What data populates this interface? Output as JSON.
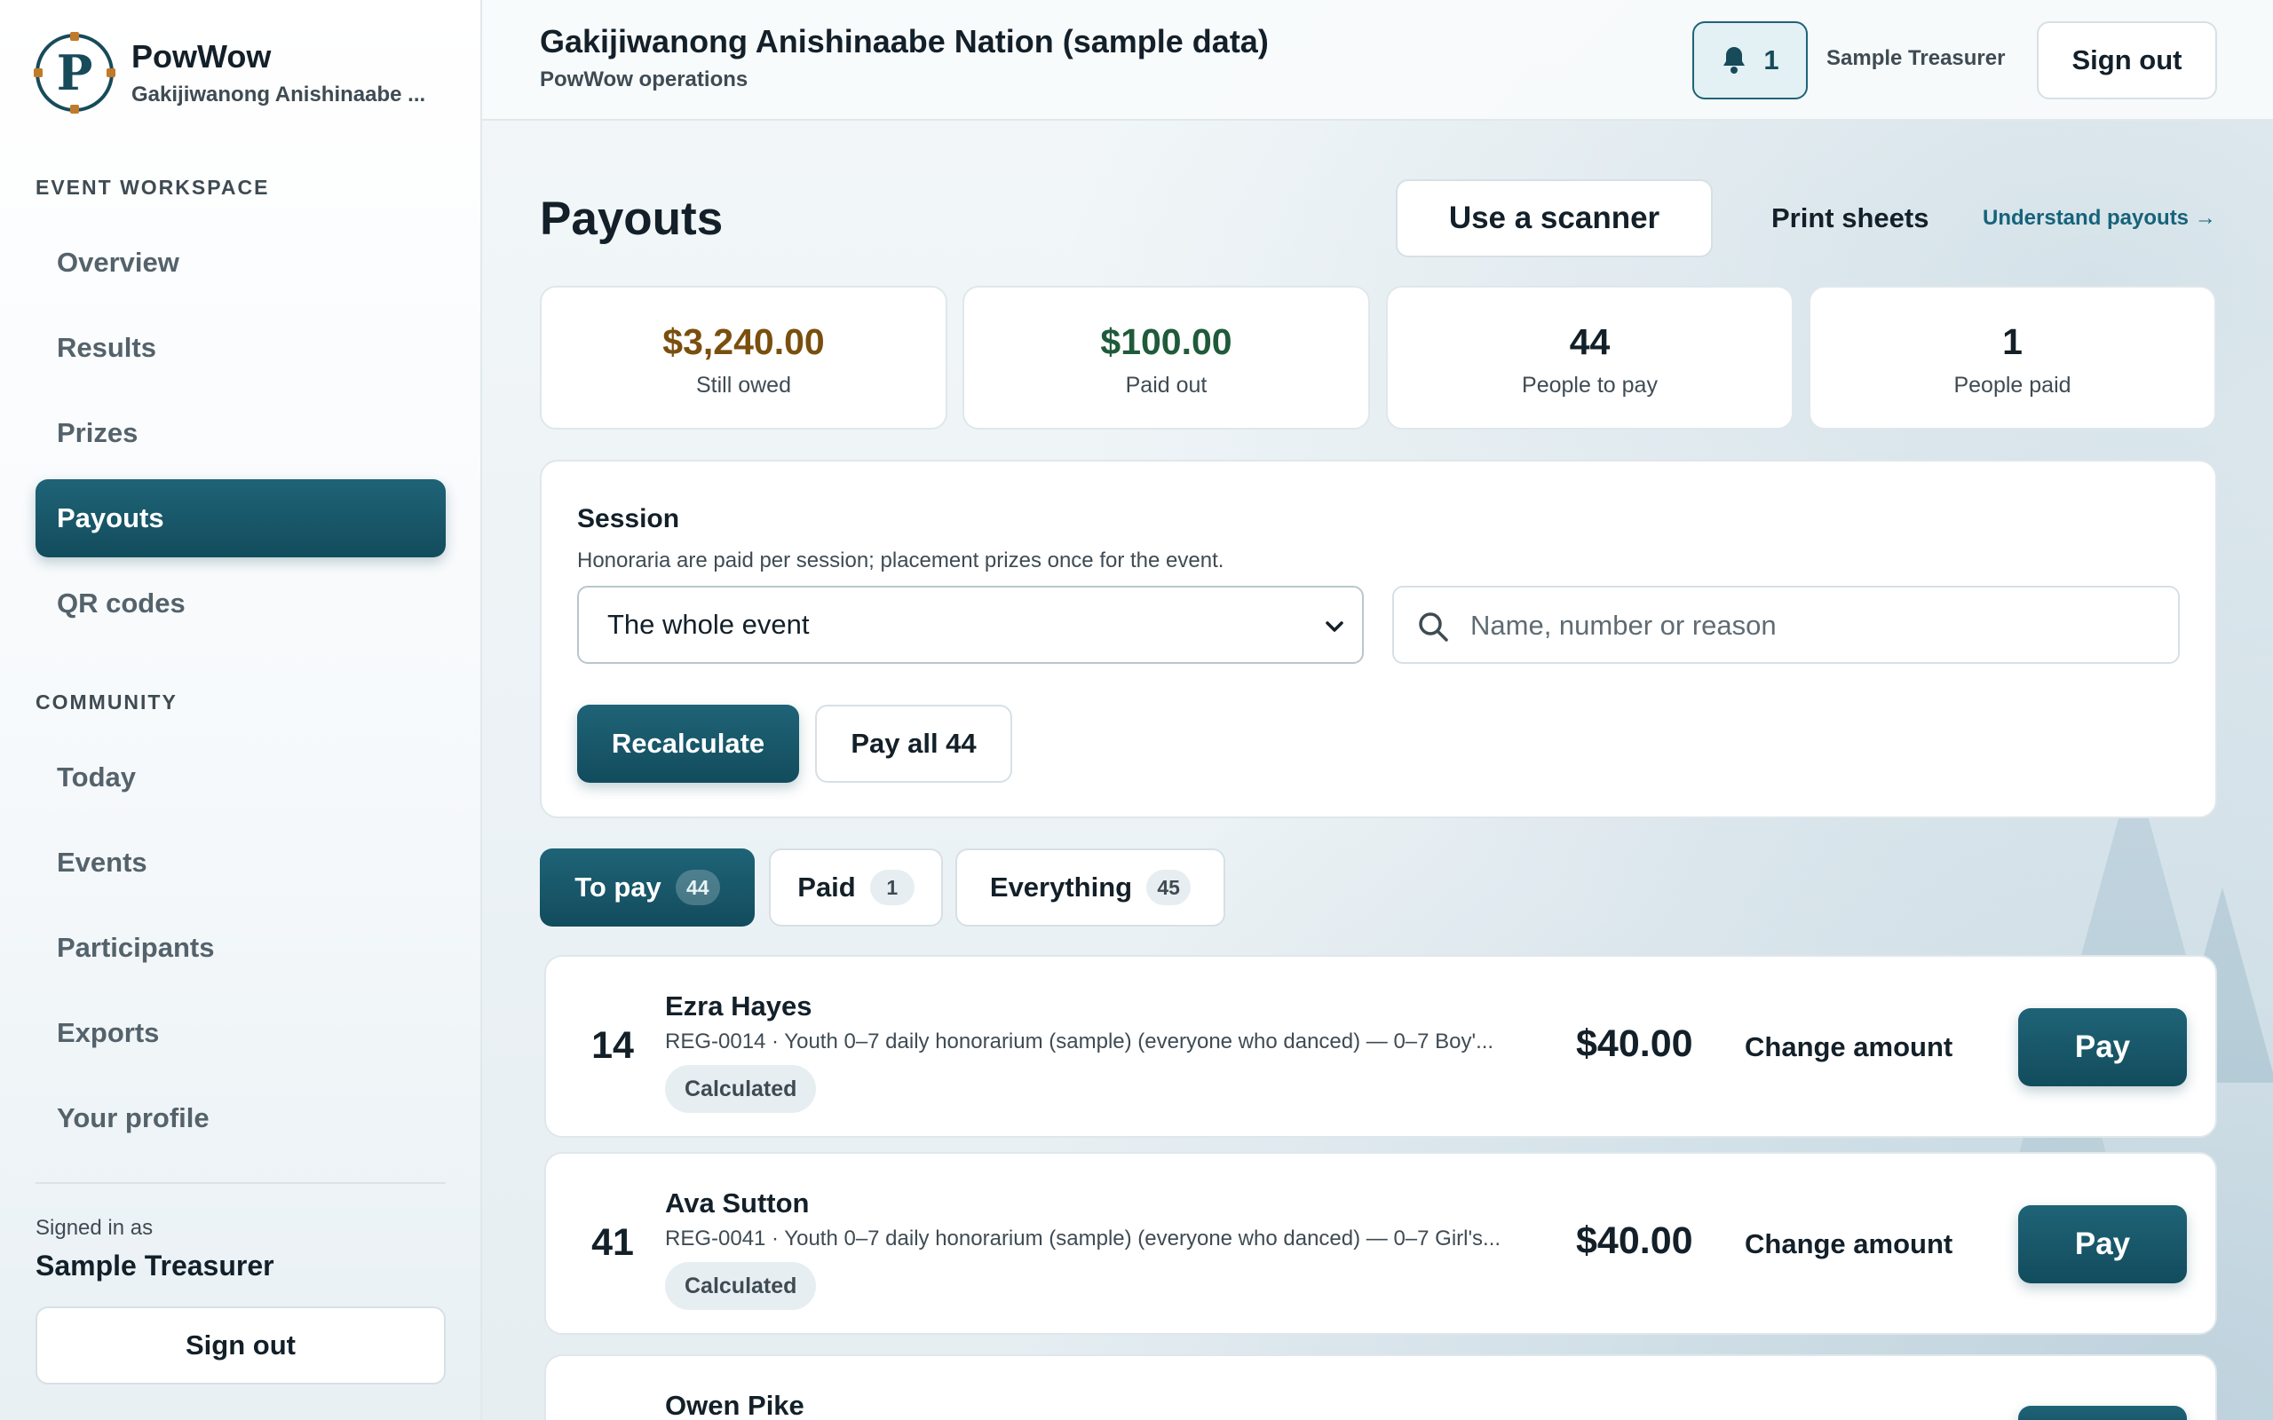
{
  "brand": {
    "name": "PowWow",
    "org_short": "Gakijiwanong Anishinaabe ...",
    "logo_letter": "P"
  },
  "sidebar": {
    "workspace_label": "EVENT WORKSPACE",
    "workspace_items": [
      {
        "label": "Overview",
        "active": false
      },
      {
        "label": "Results",
        "active": false
      },
      {
        "label": "Prizes",
        "active": false
      },
      {
        "label": "Payouts",
        "active": true
      },
      {
        "label": "QR codes",
        "active": false
      }
    ],
    "community_label": "COMMUNITY",
    "community_items": [
      {
        "label": "Today"
      },
      {
        "label": "Events"
      },
      {
        "label": "Participants"
      },
      {
        "label": "Exports"
      },
      {
        "label": "Your profile"
      }
    ],
    "signed_in_label": "Signed in as",
    "signed_in_name": "Sample Treasurer",
    "sign_out_label": "Sign out"
  },
  "header": {
    "org_title": "Gakijiwanong Anishinaabe Nation (sample data)",
    "org_subtitle": "PowWow operations",
    "notification_count": "1",
    "user_name": "Sample Treasurer",
    "sign_out_label": "Sign out"
  },
  "page": {
    "title": "Payouts",
    "scanner_label": "Use a scanner",
    "print_label": "Print sheets",
    "understand_label": "Understand payouts →"
  },
  "stats": [
    {
      "value": "$3,240.00",
      "label": "Still owed",
      "color": "#7a4f0e"
    },
    {
      "value": "$100.00",
      "label": "Paid out",
      "color": "#1f5b3a"
    },
    {
      "value": "44",
      "label": "People to pay",
      "color": "#132029"
    },
    {
      "value": "1",
      "label": "People paid",
      "color": "#132029"
    }
  ],
  "session": {
    "title": "Session",
    "hint": "Honoraria are paid per session; placement prizes once for the event.",
    "selected": "The whole event",
    "search_placeholder": "Name, number or reason",
    "recalculate_label": "Recalculate",
    "pay_all_label": "Pay all 44"
  },
  "tabs": [
    {
      "label": "To pay",
      "count": "44",
      "active": true
    },
    {
      "label": "Paid",
      "count": "1",
      "active": false
    },
    {
      "label": "Everything",
      "count": "45",
      "active": false
    }
  ],
  "payouts": [
    {
      "number": "14",
      "name": "Ezra Hayes",
      "description": "REG-0014 · Youth 0–7 daily honorarium (sample) (everyone who danced) — 0–7 Boy'...",
      "badge": "Calculated",
      "amount": "$40.00",
      "change_label": "Change amount",
      "pay_label": "Pay"
    },
    {
      "number": "41",
      "name": "Ava Sutton",
      "description": "REG-0041 · Youth 0–7 daily honorarium (sample) (everyone who danced) — 0–7 Girl's...",
      "badge": "Calculated",
      "amount": "$40.00",
      "change_label": "Change amount",
      "pay_label": "Pay"
    },
    {
      "number": "",
      "name": "Owen Pike",
      "description": "",
      "badge": "",
      "amount": "",
      "change_label": "",
      "pay_label": ""
    }
  ],
  "colors": {
    "accent": "#174b5a",
    "accent_light": "#1f6377",
    "owed": "#7a4f0e",
    "paid": "#1f5b3a"
  },
  "icons": {
    "bell": "bell-icon",
    "search": "search-icon",
    "chevron": "chevron-down-icon",
    "logo": "compass-logo-icon"
  }
}
